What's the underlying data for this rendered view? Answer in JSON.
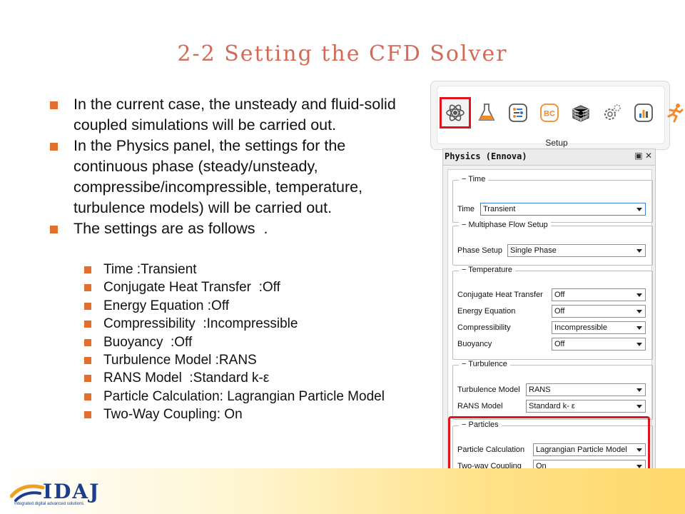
{
  "slide": {
    "title": "2-2 Setting the CFD Solver",
    "bullets": [
      "In the current case, the unsteady and fluid-solid coupled simulations will be carried out.",
      "In the Physics panel, the settings for the continuous phase (steady/unsteady, compressibe/incompressible, temperature, turbulence models) will be carried out.",
      "The settings are as follows  ."
    ],
    "sub_bullets": [
      "Time :Transient",
      "Conjugate Heat Transfer  :Off",
      "Energy Equation :Off",
      "Compressibility  :Incompressible",
      "Buoyancy  :Off",
      "Turbulence Model :RANS",
      "RANS Model  :Standard k-ε",
      "Particle Calculation: Lagrangian Particle Model",
      "Two-Way Coupling: On"
    ]
  },
  "toolbar": {
    "label": "Setup",
    "icons": [
      "atom-icon",
      "flask-icon",
      "flow-icon",
      "bc-icon",
      "grid-cube-icon",
      "gears-icon",
      "chart-icon",
      "runner-icon"
    ],
    "bc_text": "BC"
  },
  "panel": {
    "title": "Physics (Ennova)",
    "controls": "▣ ✕",
    "groups": {
      "time": {
        "header": "− Time",
        "label": "Time",
        "value": "Transient"
      },
      "multiphase": {
        "header": "− Multiphase Flow Setup",
        "label": "Phase Setup",
        "value": "Single Phase"
      },
      "temperature": {
        "header": "− Temperature",
        "rows": [
          {
            "label": "Conjugate Heat Transfer",
            "value": "Off"
          },
          {
            "label": "Energy Equation",
            "value": "Off"
          },
          {
            "label": "Compressibility",
            "value": "Incompressible"
          },
          {
            "label": "Buoyancy",
            "value": "Off"
          }
        ]
      },
      "turbulence": {
        "header": "− Turbulence",
        "rows": [
          {
            "label": "Turbulence Model",
            "value": "RANS"
          },
          {
            "label": "RANS Model",
            "value": "Standard k- ε"
          }
        ]
      },
      "particles": {
        "header": "− Particles",
        "rows": [
          {
            "label": "Particle Calculation",
            "value": "Lagrangian Particle Model"
          },
          {
            "label": "Two-way Coupling",
            "value": "On"
          }
        ]
      }
    }
  },
  "footer": {
    "logo_text": "IDAJ",
    "logo_sub": "Integrated digital advanced solutions"
  },
  "colors": {
    "accent": "#e0702c",
    "title": "#d36a58",
    "highlight": "#e0141e"
  }
}
